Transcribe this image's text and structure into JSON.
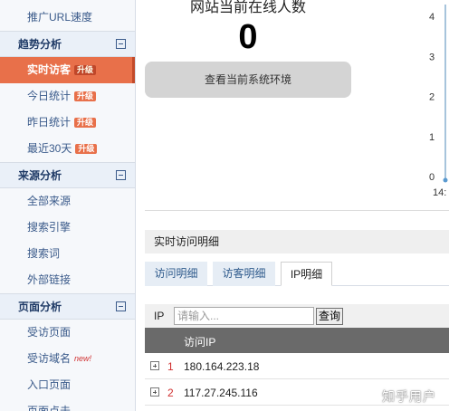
{
  "sidebar": {
    "items": [
      {
        "type": "item",
        "label": "推广URL速度"
      },
      {
        "type": "section",
        "label": "趋势分析"
      },
      {
        "type": "item",
        "label": "实时访客",
        "badge": "升级",
        "active": true
      },
      {
        "type": "item",
        "label": "今日统计",
        "badge": "升级"
      },
      {
        "type": "item",
        "label": "昨日统计",
        "badge": "升级"
      },
      {
        "type": "item",
        "label": "最近30天",
        "badge": "升级"
      },
      {
        "type": "section",
        "label": "来源分析"
      },
      {
        "type": "item",
        "label": "全部来源"
      },
      {
        "type": "item",
        "label": "搜索引擎"
      },
      {
        "type": "item",
        "label": "搜索词"
      },
      {
        "type": "item",
        "label": "外部链接"
      },
      {
        "type": "section",
        "label": "页面分析"
      },
      {
        "type": "item",
        "label": "受访页面"
      },
      {
        "type": "item",
        "label": "受访域名",
        "new": "new!"
      },
      {
        "type": "item",
        "label": "入口页面"
      },
      {
        "type": "item",
        "label": "页面点击"
      }
    ]
  },
  "online": {
    "title": "网站当前在线人数",
    "count": "0",
    "env_button": "查看当前系统环境"
  },
  "mini_chart": {
    "y_ticks": [
      "4",
      "3",
      "2",
      "1",
      "0"
    ],
    "x_label": "14:"
  },
  "detail": {
    "header": "实时访问明细",
    "tabs": [
      {
        "label": "访问明细",
        "selected": false
      },
      {
        "label": "访客明细",
        "selected": false
      },
      {
        "label": "IP明细",
        "selected": true
      }
    ],
    "filter": {
      "label": "IP",
      "placeholder": "请输入...",
      "button": "查询"
    },
    "table": {
      "column": "访问IP",
      "rows": [
        {
          "num": "1",
          "ip": "180.164.223.18"
        },
        {
          "num": "2",
          "ip": "117.27.245.116"
        }
      ]
    }
  },
  "watermark": "知乎用户",
  "colors": {
    "accent": "#e8704a",
    "sidebar_link": "#3a5a8a",
    "table_header": "#6a6a6a",
    "row_number": "#d03030"
  }
}
